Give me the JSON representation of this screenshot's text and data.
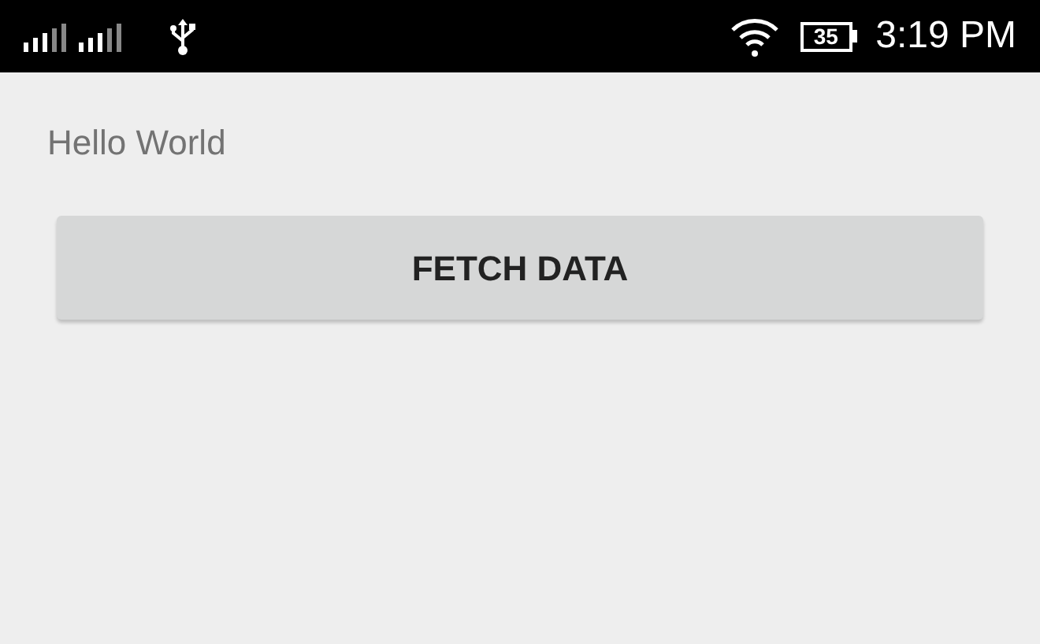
{
  "status_bar": {
    "battery": "35",
    "time": "3:19 PM"
  },
  "content": {
    "text": "Hello World",
    "button": "FETCH DATA"
  }
}
